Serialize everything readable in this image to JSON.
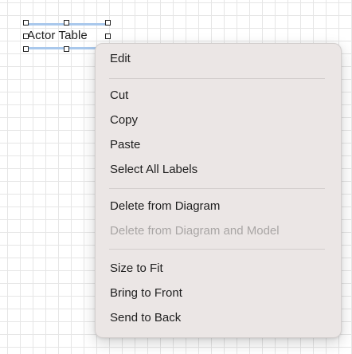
{
  "diagram": {
    "label_text": "Actor Table"
  },
  "context_menu": {
    "edit": "Edit",
    "cut": "Cut",
    "copy": "Copy",
    "paste": "Paste",
    "select_all_labels": "Select All Labels",
    "delete_from_diagram": "Delete from Diagram",
    "delete_from_diagram_and_model": "Delete from Diagram and Model",
    "size_to_fit": "Size to Fit",
    "bring_to_front": "Bring to Front",
    "send_to_back": "Send to Back"
  },
  "colors": {
    "menu_background": "#ebe6e5",
    "disabled_text": "#a9a6a5",
    "selection": "#a9c8ec"
  }
}
